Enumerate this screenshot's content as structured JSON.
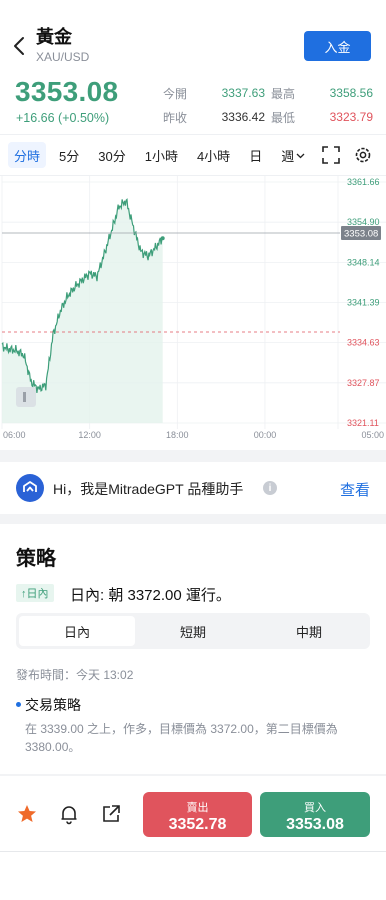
{
  "header": {
    "title": "黃金",
    "subtitle": "XAU/USD",
    "deposit_label": "入金"
  },
  "quote": {
    "price": "3353.08",
    "change": "+16.66 (+0.50%)",
    "stats": {
      "open_label": "今開",
      "open_value": "3337.63",
      "high_label": "最高",
      "high_value": "3358.56",
      "prev_label": "昨收",
      "prev_value": "3336.42",
      "low_label": "最低",
      "low_value": "3323.79"
    }
  },
  "timeframes": [
    "分時",
    "5分",
    "30分",
    "1小時",
    "4小時",
    "日",
    "週"
  ],
  "icons": {
    "back": "back-icon",
    "fullscreen": "fullscreen-icon",
    "settings": "gear-icon",
    "star": "star-icon",
    "bell": "bell-icon",
    "share": "share-icon",
    "info": "info-icon",
    "assistant": "assistant-logo-icon"
  },
  "colors": {
    "up": "#3e9e7a",
    "down": "#e0545d",
    "accent": "#1f6fe0"
  },
  "chart_data": {
    "type": "area",
    "x_ticks": [
      "06:00",
      "12:00",
      "18:00",
      "00:00",
      "05:00"
    ],
    "y_ticks": [
      "3361.66",
      "3354.90",
      "3348.14",
      "3341.39",
      "3334.63",
      "3327.87",
      "3321.11"
    ],
    "ylim": [
      3321.11,
      3361.66
    ],
    "current_price_label": "3353.08",
    "x": [
      0,
      0.5,
      1,
      1.5,
      2,
      2.5,
      3,
      3.5,
      4,
      4.5,
      5,
      5.5,
      6,
      6.5,
      7,
      7.5,
      8,
      8.5,
      9,
      9.5,
      10,
      10.5,
      11
    ],
    "values": [
      3334,
      3333.5,
      3333.3,
      3332.5,
      3328,
      3326.8,
      3327.5,
      3336,
      3340,
      3342.5,
      3344,
      3345.2,
      3346.3,
      3345.8,
      3349.5,
      3353.5,
      3357.5,
      3358.5,
      3354,
      3350,
      3349.2,
      3350.6,
      3352.2
    ]
  },
  "gpt": {
    "text": "Hi，我是MitradeGPT 品種助手",
    "link": "查看"
  },
  "strategy": {
    "title": "策略",
    "badge": "↑日內",
    "line": "日內: 朝 3372.00 運行。",
    "tabs": [
      "日內",
      "短期",
      "中期"
    ],
    "published": "發布時間：今天 13:02",
    "trade_title": "交易策略",
    "trade_desc": "在 3339.00 之上，作多，目標價為 3372.00，第二目標價為 3380.00。"
  },
  "bottom": {
    "sell_label": "賣出",
    "sell_price": "3352.78",
    "buy_label": "買入",
    "buy_price": "3353.08"
  }
}
